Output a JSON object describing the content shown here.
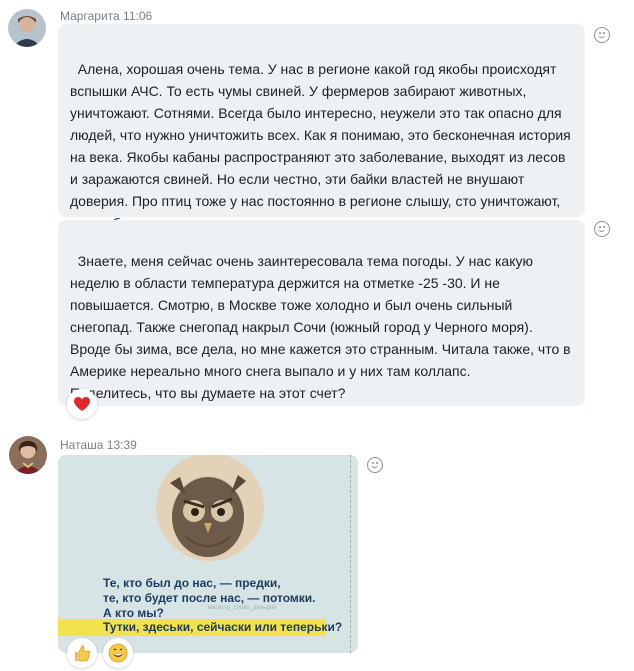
{
  "messages": [
    {
      "sender": "Маргарита",
      "time": "11:06",
      "bubbles": [
        "Алена, хорошая очень тема. У нас в регионе какой год якобы происходят вспышки АЧС. То есть чумы свиней. У фермеров забирают животных, уничтожают. Сотнями. Всегда было интересно, неужели это так опасно для людей, что нужно уничтожить всех. Как я понимаю, это бесконечная история на века. Якобы кабаны распространяют это заболевание, выходят из лесов и заражаются свиней. Но если честно, эти байки властей не внушают доверия. Про птиц тоже у нас постоянно в регионе слышу, сто уничтожают, если обнаружат.",
        "Знаете, меня сейчас очень заинтересовала тема погоды. У нас какую неделю в области температура держится на отметке -25 -30. И не повышается. Смотрю, в Москве тоже холодно и был очень сильный снегопад. Также снегопад накрыл Сочи (южный город у Черного моря). Вроде бы зима, все дела, но мне кажется это странным. Читала также, что в Америке нереально много снега выпало и у них там коллапс.\nПоделитесь, что вы думаете на этот счет?"
      ],
      "reaction": "heart-icon"
    },
    {
      "sender": "Наташа",
      "time": "13:39",
      "image": {
        "quote_lines": "Те, кто был до нас, — предки,\nте, кто будет после нас, — потомки.\nА кто мы?",
        "highlight": "Тутки, здеськи, сейчаски или теперьки?",
        "caption": "магистр_слово_деньдня"
      },
      "reactions": [
        "thumbs-up-icon",
        "grinning-face-icon"
      ]
    }
  ],
  "colors": {
    "bubble_bg": "#eef1f4",
    "heart": "#e0282e",
    "highlight": "#f2e24e",
    "quote_text": "#1e3a5f",
    "image_bg": "#d7e4e5"
  }
}
